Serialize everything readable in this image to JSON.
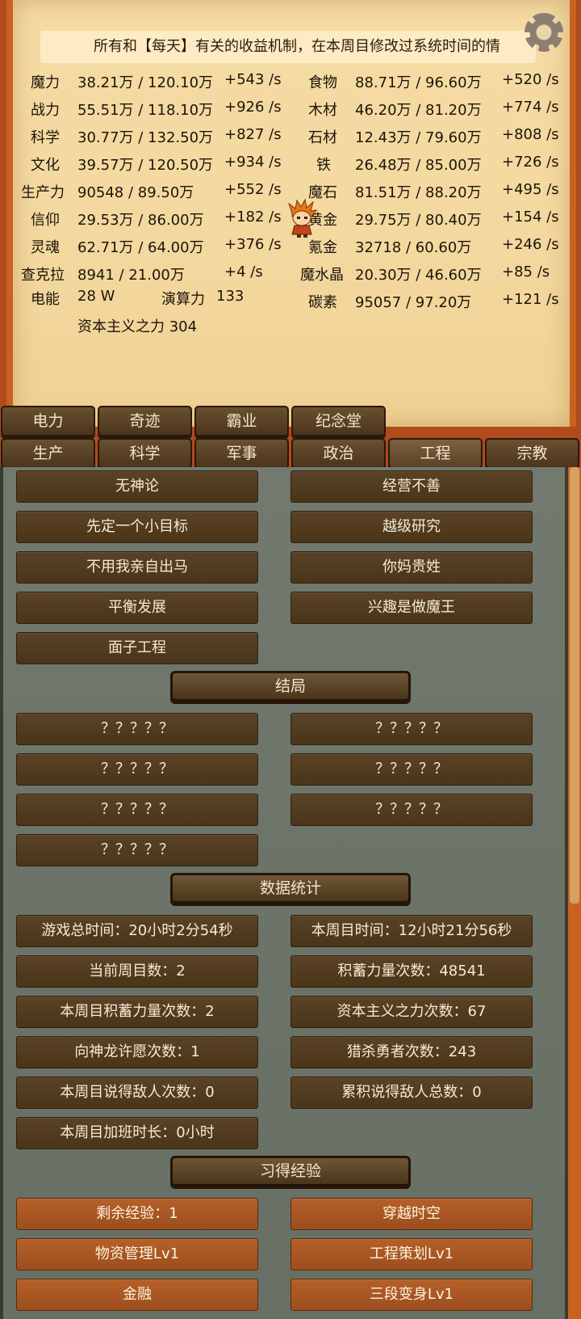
{
  "notice": "所有和【每天】有关的收益机制，在本周目修改过系统时间的情",
  "resources_left": [
    {
      "name": "魔力",
      "value": "38.21万 / 120.10万",
      "rate": "+543 /s"
    },
    {
      "name": "战力",
      "value": "55.51万 / 118.10万",
      "rate": "+926 /s"
    },
    {
      "name": "科学",
      "value": "30.77万 / 132.50万",
      "rate": "+827 /s"
    },
    {
      "name": "文化",
      "value": "39.57万 / 120.50万",
      "rate": "+934 /s"
    },
    {
      "name": "生产力",
      "value": "90548 / 89.50万",
      "rate": "+552 /s"
    },
    {
      "name": "信仰",
      "value": "29.53万 / 86.00万",
      "rate": "+182 /s"
    },
    {
      "name": "灵魂",
      "value": "62.71万 / 64.00万",
      "rate": "+376 /s"
    },
    {
      "name": "查克拉",
      "value": "8941 / 21.00万",
      "rate": "+4 /s"
    }
  ],
  "resources_right": [
    {
      "name": "食物",
      "value": "88.71万 / 96.60万",
      "rate": "+520 /s"
    },
    {
      "name": "木材",
      "value": "46.20万 / 81.20万",
      "rate": "+774 /s"
    },
    {
      "name": "石材",
      "value": "12.43万 / 79.60万",
      "rate": "+808 /s"
    },
    {
      "name": "铁",
      "value": "26.48万 / 85.00万",
      "rate": "+726 /s"
    },
    {
      "name": "魔石",
      "value": "81.51万 / 88.20万",
      "rate": "+495 /s"
    },
    {
      "name": "黄金",
      "value": "29.75万 / 80.40万",
      "rate": "+154 /s"
    },
    {
      "name": "氪金",
      "value": "32718 / 60.60万",
      "rate": "+246 /s"
    },
    {
      "name": "魔水晶",
      "value": "20.30万 / 46.60万",
      "rate": "+85 /s"
    },
    {
      "name": "碳素",
      "value": "95057 / 97.20万",
      "rate": "+121 /s"
    }
  ],
  "power": {
    "label": "电能",
    "value": "28 W"
  },
  "compute": {
    "label": "演算力",
    "value": "133"
  },
  "capitalism": "资本主义之力 304",
  "tabs_row1": [
    "电力",
    "奇迹",
    "霸业",
    "纪念堂"
  ],
  "tabs_row2": [
    "生产",
    "科学",
    "军事",
    "政治",
    "工程",
    "宗教"
  ],
  "active_tab": "工程",
  "achievements": [
    "无神论",
    "经营不善",
    "先定一个小目标",
    "越级研究",
    "不用我亲自出马",
    "你妈贵姓",
    "平衡发展",
    "兴趣是做魔王",
    "面子工程"
  ],
  "endings_header": "结局",
  "endings": [
    "？？？？？",
    "？？？？？",
    "？？？？？",
    "？？？？？",
    "？？？？？",
    "？？？？？",
    "？？？？？"
  ],
  "stats_header": "数据统计",
  "stats": [
    "游戏总时间：20小时2分54秒",
    "本周目时间：12小时21分56秒",
    "当前周目数：2",
    "积蓄力量次数：48541",
    "本周目积蓄力量次数：2",
    "资本主义之力次数：67",
    "向神龙许愿次数：1",
    "猎杀勇者次数：243",
    "本周目说得敌人次数：0",
    "累积说得敌人总数：0",
    "本周目加班时长：0小时"
  ],
  "exp_header": "习得经验",
  "exp": [
    "剩余经验：1",
    "穿越时空",
    "物资管理Lv1",
    "工程策划Lv1",
    "金融",
    "三段变身Lv1"
  ],
  "colors": {
    "accent": "#c9611f",
    "parchment": "#f3d89f",
    "button": "#4a3519",
    "exp_button": "#a8562a"
  },
  "icons": {
    "settings": "gear-icon",
    "avatar": "hero-sprite"
  }
}
